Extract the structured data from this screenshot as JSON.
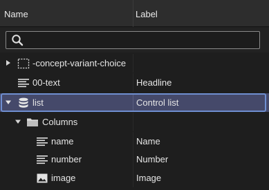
{
  "header": {
    "name_col": "Name",
    "label_col": "Label"
  },
  "search": {
    "placeholder": "",
    "value": ""
  },
  "tree": [
    {
      "name": "-concept-variant-choice",
      "label": "",
      "icon": "dashed-box-icon",
      "expander": "collapsed",
      "selected": false
    },
    {
      "name": "00-text",
      "label": "Headline",
      "icon": "text-lines-icon",
      "expander": "none",
      "selected": false
    },
    {
      "name": "list",
      "label": "Control list",
      "icon": "database-icon",
      "expander": "expanded",
      "selected": true
    },
    {
      "name": "Columns",
      "label": "",
      "icon": "folder-icon",
      "expander": "expanded",
      "selected": false
    },
    {
      "name": "name",
      "label": "Name",
      "icon": "text-lines-icon",
      "expander": "none",
      "selected": false
    },
    {
      "name": "number",
      "label": "Number",
      "icon": "text-lines-icon",
      "expander": "none",
      "selected": false
    },
    {
      "name": "image",
      "label": "Image",
      "icon": "image-icon",
      "expander": "none",
      "selected": false
    }
  ],
  "colors": {
    "selection": "#45496a",
    "selection_border": "#6f8fd1",
    "background": "#1e1e1e",
    "header": "#2d2d2d"
  }
}
